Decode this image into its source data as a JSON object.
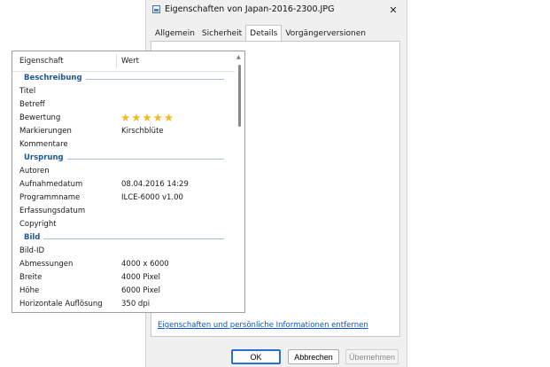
{
  "window": {
    "title": "Eigenschaften von Japan-2016-2300.JPG",
    "close_glyph": "✕"
  },
  "tabs": [
    {
      "label": "Allgemein"
    },
    {
      "label": "Sicherheit"
    },
    {
      "label": "Details",
      "active": true
    },
    {
      "label": "Vorgängerversionen"
    }
  ],
  "list": {
    "header": {
      "property": "Eigenschaft",
      "value": "Wert"
    },
    "sections": [
      {
        "title": "Beschreibung",
        "rows": [
          {
            "name": "Titel",
            "value": ""
          },
          {
            "name": "Betreff",
            "value": ""
          },
          {
            "name": "Bewertung",
            "value": "",
            "rating": 5
          },
          {
            "name": "Markierungen",
            "value": "Kirschblüte"
          },
          {
            "name": "Kommentare",
            "value": ""
          }
        ]
      },
      {
        "title": "Ursprung",
        "rows": [
          {
            "name": "Autoren",
            "value": ""
          },
          {
            "name": "Aufnahmedatum",
            "value": "08.04.2016 14:29"
          },
          {
            "name": "Programmname",
            "value": "ILCE-6000 v1.00"
          },
          {
            "name": "Erfassungsdatum",
            "value": ""
          },
          {
            "name": "Copyright",
            "value": ""
          }
        ]
      },
      {
        "title": "Bild",
        "rows": [
          {
            "name": "Bild-ID",
            "value": ""
          },
          {
            "name": "Abmessungen",
            "value": "4000 x 6000"
          },
          {
            "name": "Breite",
            "value": "4000 Pixel"
          },
          {
            "name": "Höhe",
            "value": "6000 Pixel"
          },
          {
            "name": "Horizontale Auflösung",
            "value": "350 dpi"
          }
        ]
      }
    ]
  },
  "remove_link": "Eigenschaften und persönliche Informationen entfernen",
  "buttons": {
    "ok": "OK",
    "cancel": "Abbrechen",
    "apply": "Übernehmen"
  },
  "colors": {
    "group_title": "#1e5799",
    "link": "#0b57c9",
    "star": "#f1b821",
    "ok_border": "#2a6fd6"
  },
  "icons": {
    "title": "picture-file-icon",
    "close": "close-icon",
    "rating": "star-icon"
  }
}
